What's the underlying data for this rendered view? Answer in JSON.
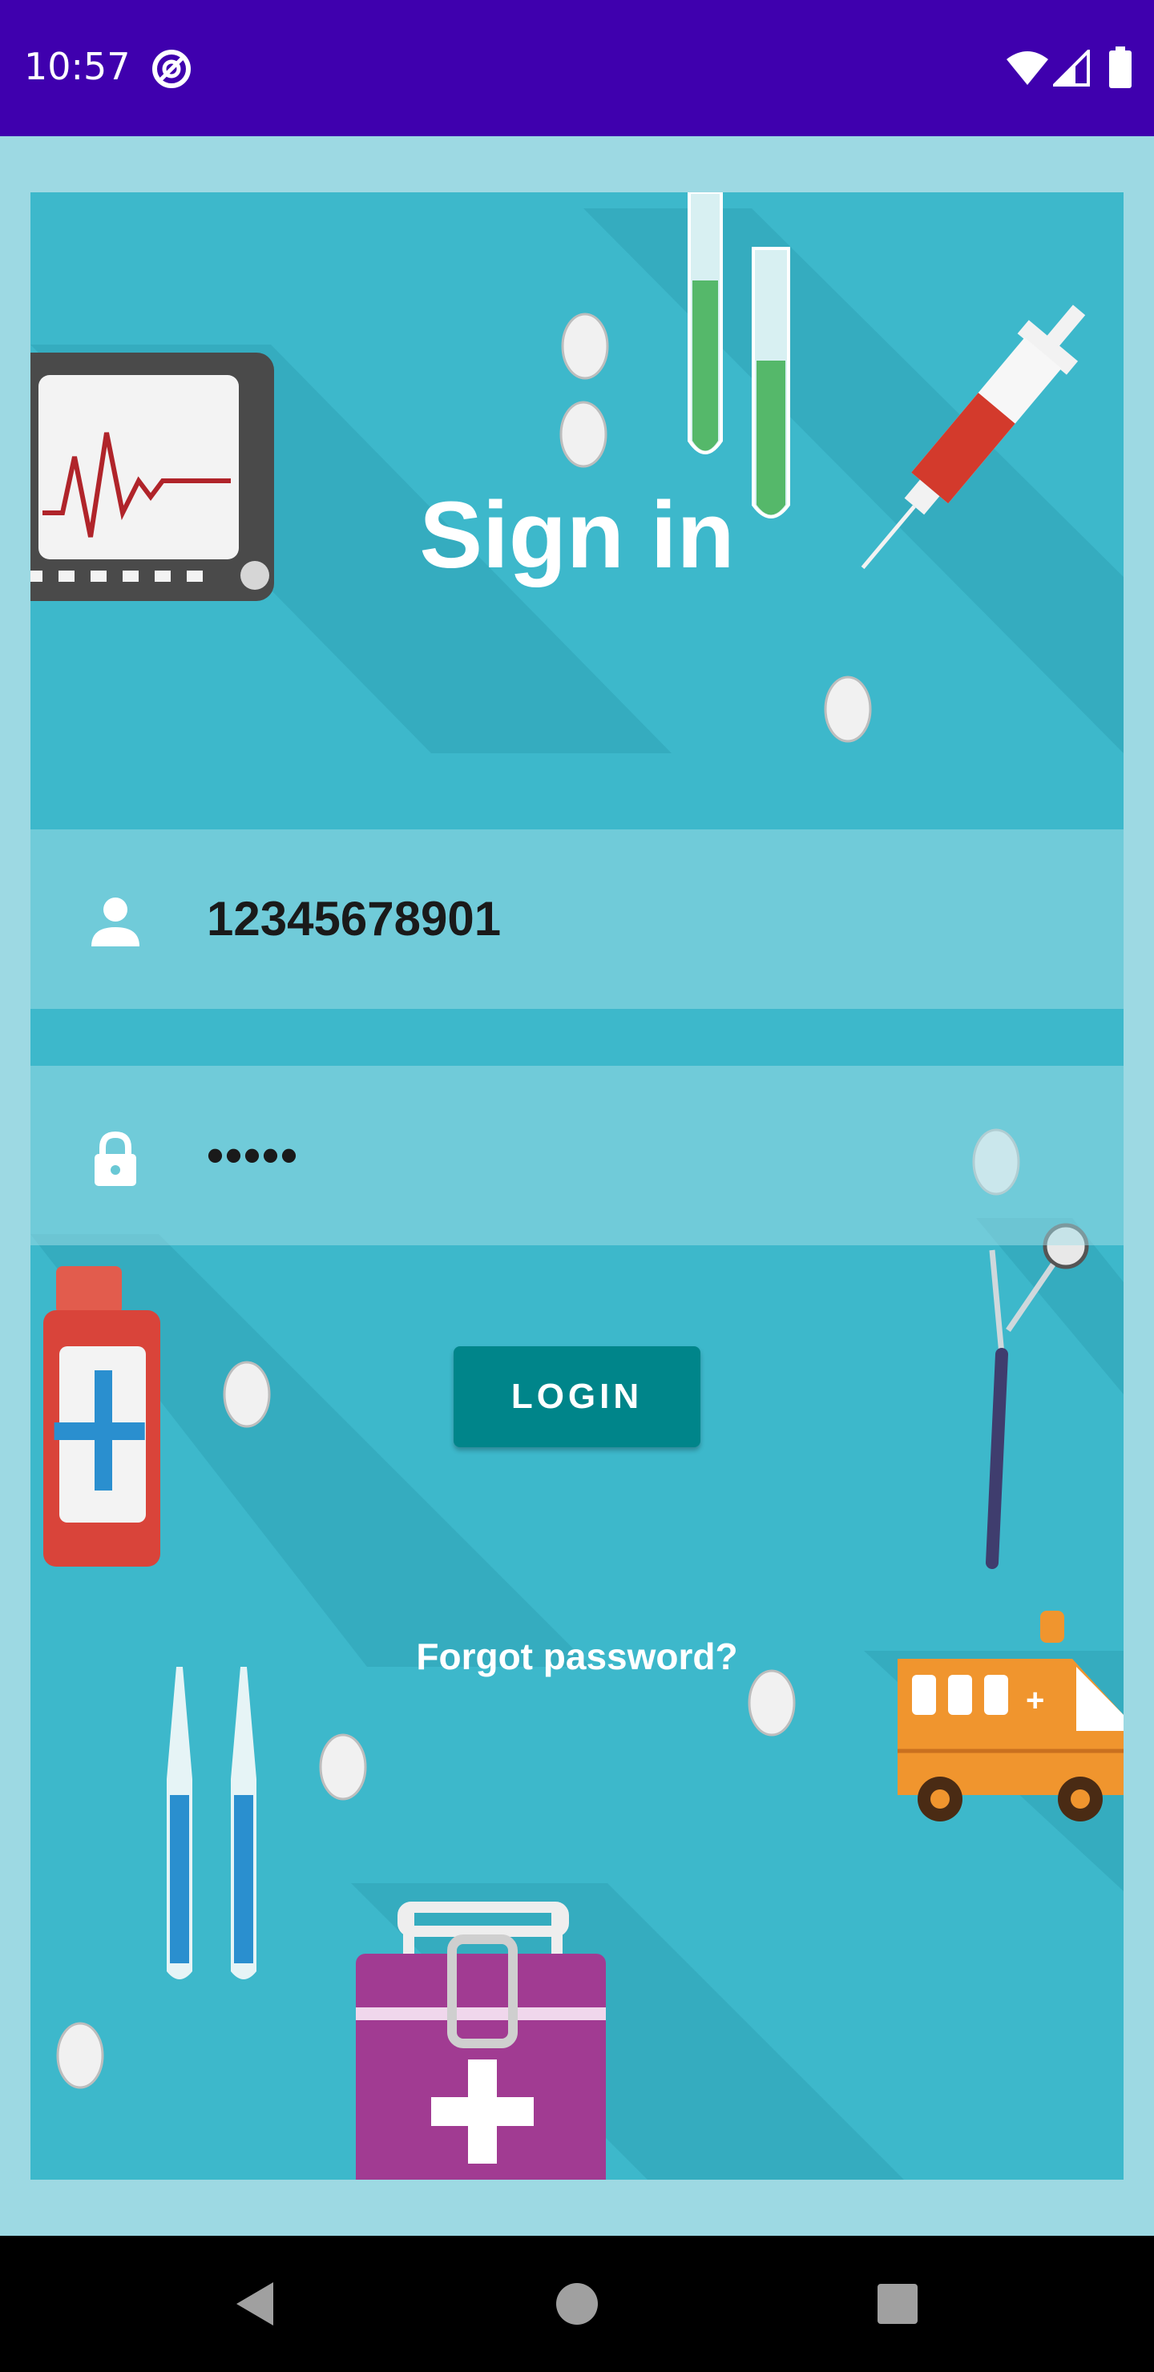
{
  "status_bar": {
    "time": "10:57",
    "icons": [
      "dnd-icon",
      "wifi-icon",
      "cell-signal-icon",
      "battery-icon"
    ]
  },
  "page": {
    "title": "Sign in"
  },
  "form": {
    "username_value": "12345678901",
    "password_value": "•••••",
    "login_label": "LOGIN",
    "forgot_label": "Forgot password?"
  },
  "nav_bar": {
    "icons": [
      "back-icon",
      "home-icon",
      "recents-icon"
    ]
  },
  "colors": {
    "status_bar": "#3F00AE",
    "panel": "#3DB8CB",
    "frame": "#9DD9E3",
    "button": "#00858A"
  }
}
